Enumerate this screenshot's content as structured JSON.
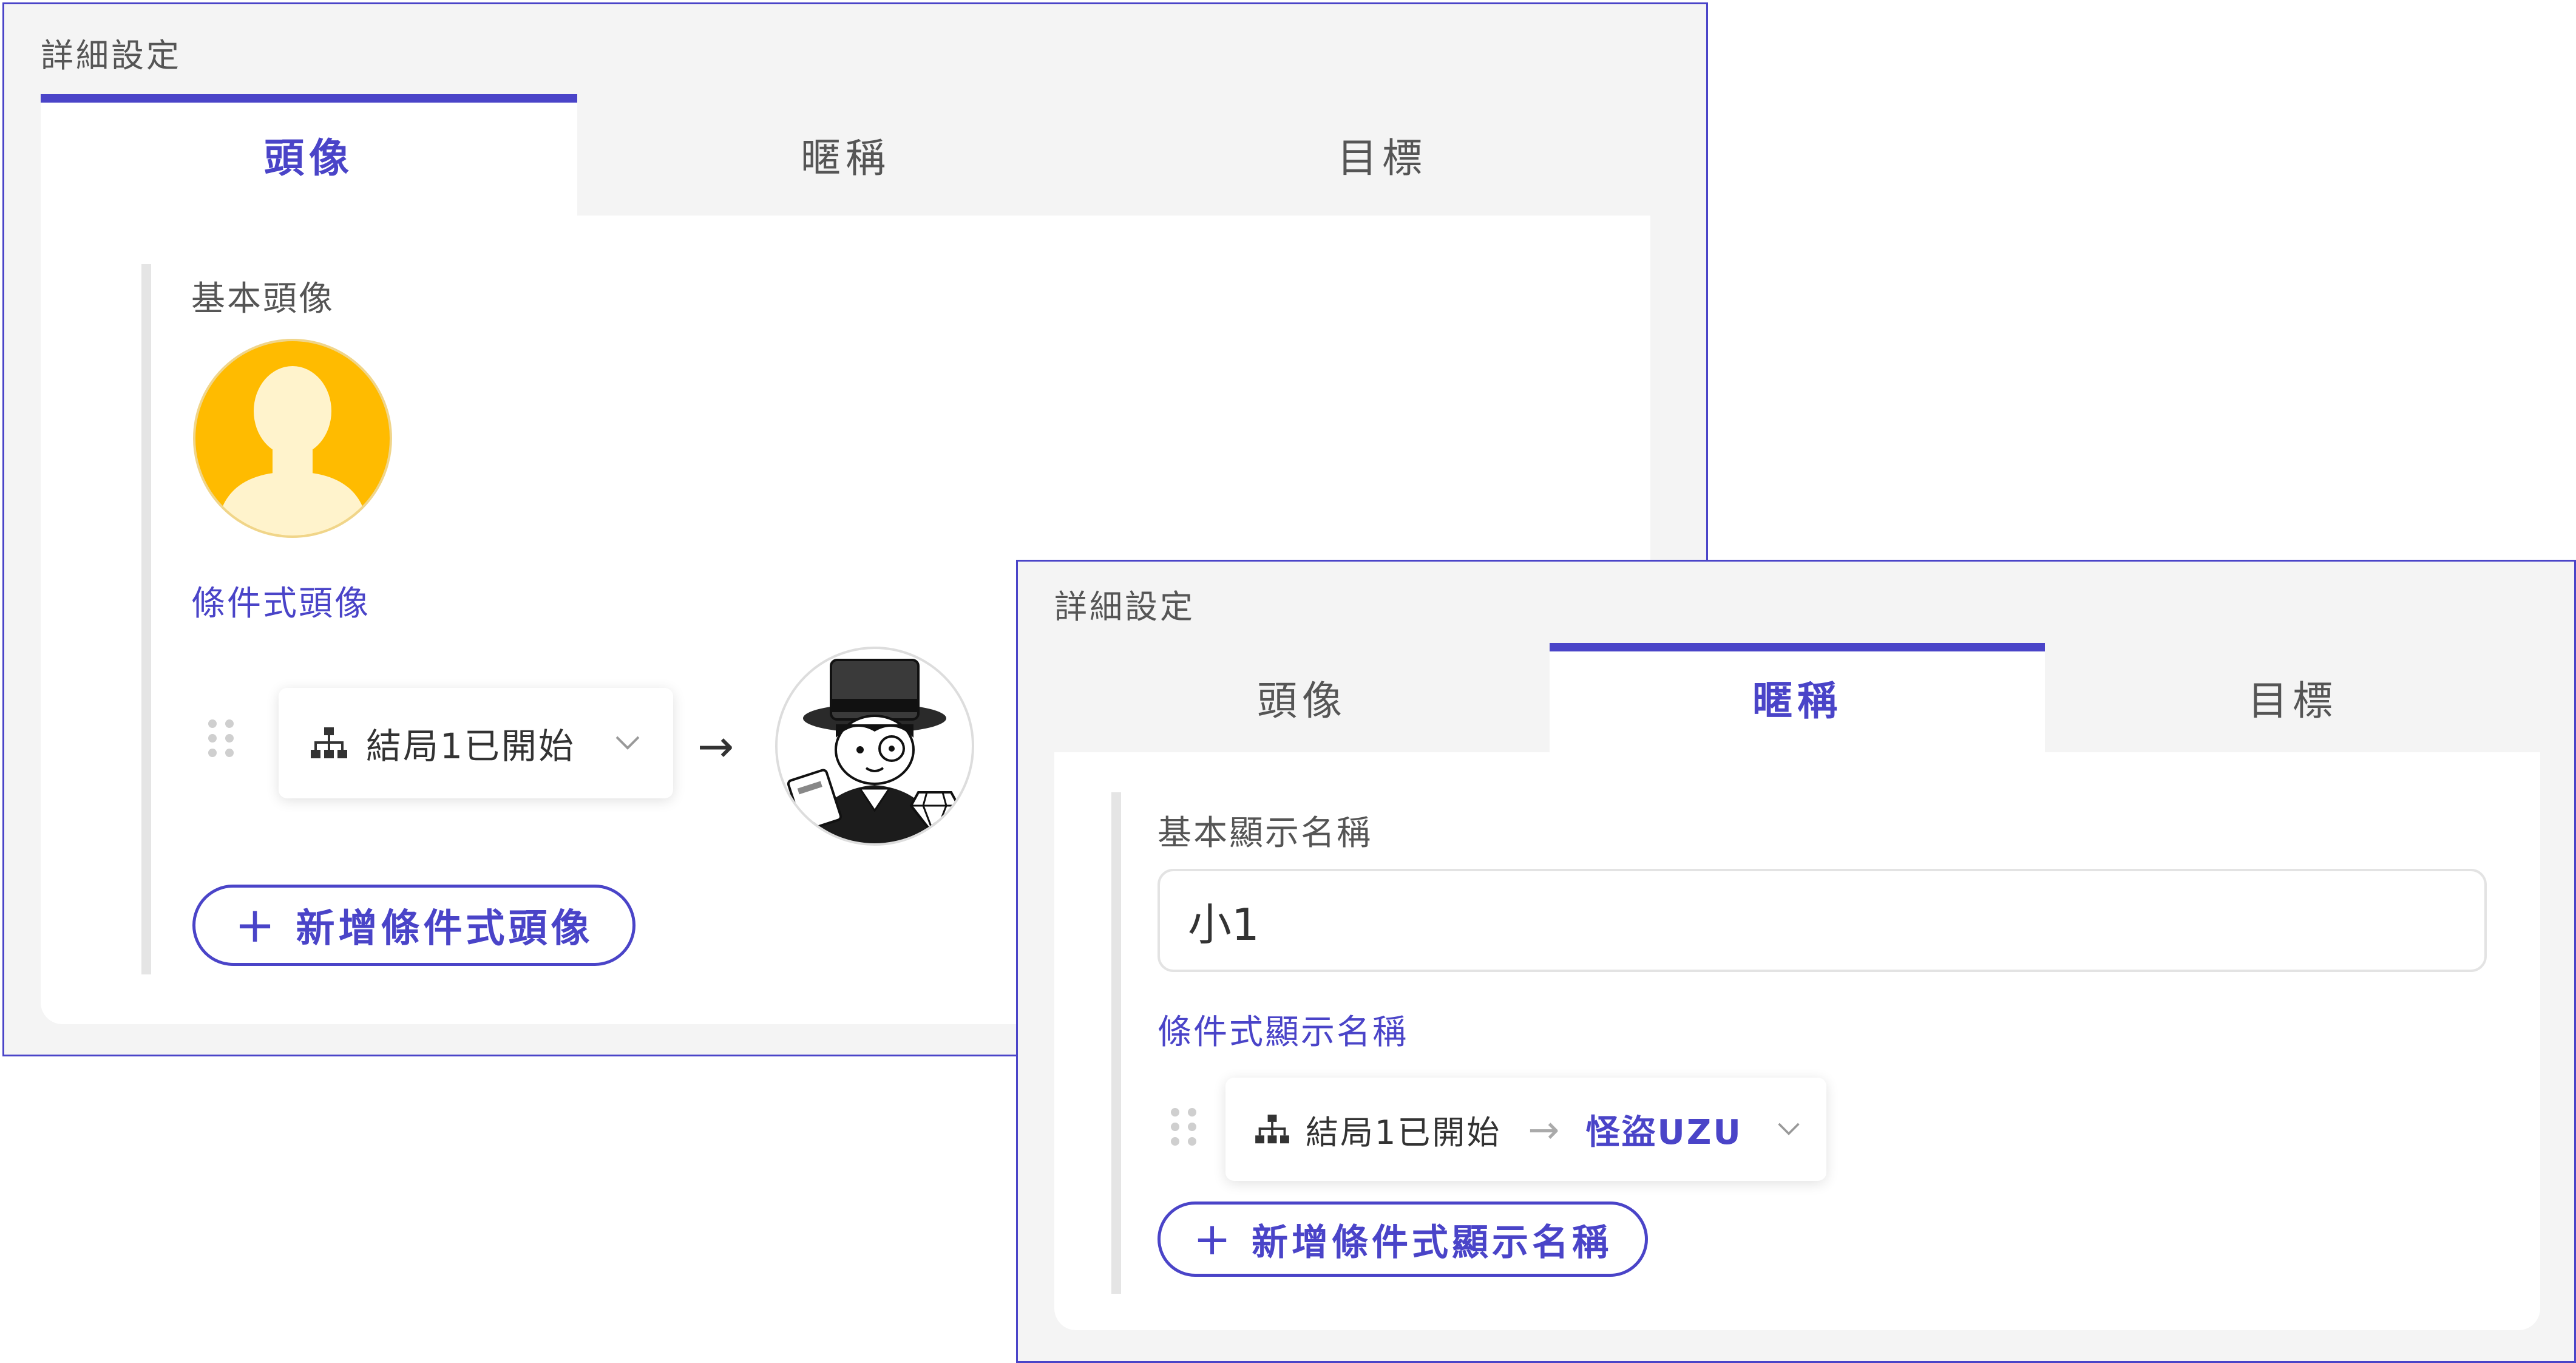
{
  "colors": {
    "accent": "#4a44c8",
    "panel_bg": "#f4f4f4",
    "avatar_orange": "#ffbb00",
    "avatar_silhouette": "#fff3cc"
  },
  "avatar_panel": {
    "title": "詳細設定",
    "tabs": [
      {
        "label": "頭像",
        "active": true
      },
      {
        "label": "暱稱",
        "active": false
      },
      {
        "label": "目標",
        "active": false
      }
    ],
    "basic_label": "基本頭像",
    "conditional_label": "條件式頭像",
    "condition": {
      "icon": "sitemap-icon",
      "text": "結局1已開始",
      "arrow": "→",
      "result_image": "top-hat-character-avatar"
    },
    "add_button": "新增條件式頭像"
  },
  "nickname_panel": {
    "title": "詳細設定",
    "tabs": [
      {
        "label": "頭像",
        "active": false
      },
      {
        "label": "暱稱",
        "active": true
      },
      {
        "label": "目標",
        "active": false
      }
    ],
    "basic_label": "基本顯示名稱",
    "basic_value": "小1",
    "conditional_label": "條件式顯示名稱",
    "condition": {
      "icon": "sitemap-icon",
      "text": "結局1已開始",
      "arrow": "→",
      "result": "怪盜UZU"
    },
    "add_button": "新增條件式顯示名稱"
  }
}
